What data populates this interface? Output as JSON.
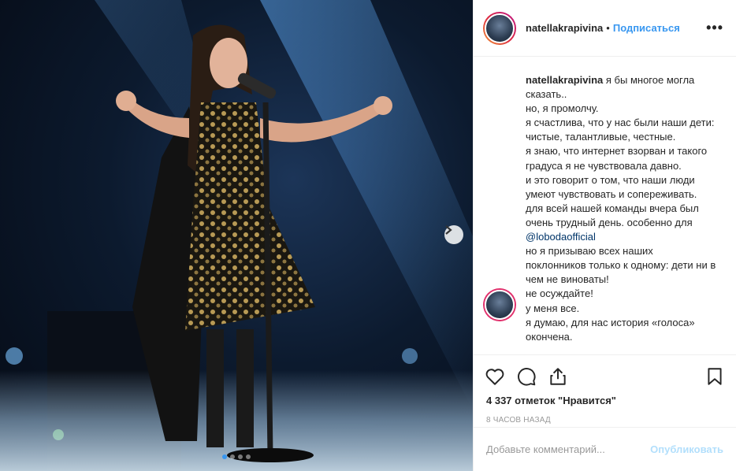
{
  "post": {
    "username": "natellakrapivina",
    "separator": "•",
    "follow_label": "Подписаться",
    "more_label": "•••",
    "photo_description_icon": "photo",
    "carousel": {
      "count": 4,
      "active": 0
    }
  },
  "caption": {
    "username": "natellakrapivina",
    "lines_part1": [
      "я бы многое могла сказать..",
      "но, я промолчу.",
      "я счастлива, что у нас были наши дети: чистые, талантливые, честные.",
      "я знаю, что интернет взорван и такого градуса я не чувствовала давно.",
      "и это говорит о том, что наши люди умеют чувствовать и сопереживать.",
      "для всей нашей команды вчера был очень трудный день. особенно для"
    ],
    "mention": "@lobodaofficial",
    "lines_part2": [
      "но я призываю всех наших поклонников только к одному: дети ни в чем не виноваты!",
      "не осуждайте!",
      "у меня все.",
      "я думаю, для нас история «голоса» окончена."
    ]
  },
  "actions": {
    "likes_text": "4 337 отметок \"Нравится\"",
    "time_text": "8 ЧАСОВ НАЗАД"
  },
  "comment_box": {
    "placeholder": "Добавьте комментарий...",
    "publish_label": "Опубликовать"
  },
  "colors": {
    "accent": "#3897f0",
    "publish_disabled": "#b2dffc",
    "mention": "#003569"
  }
}
